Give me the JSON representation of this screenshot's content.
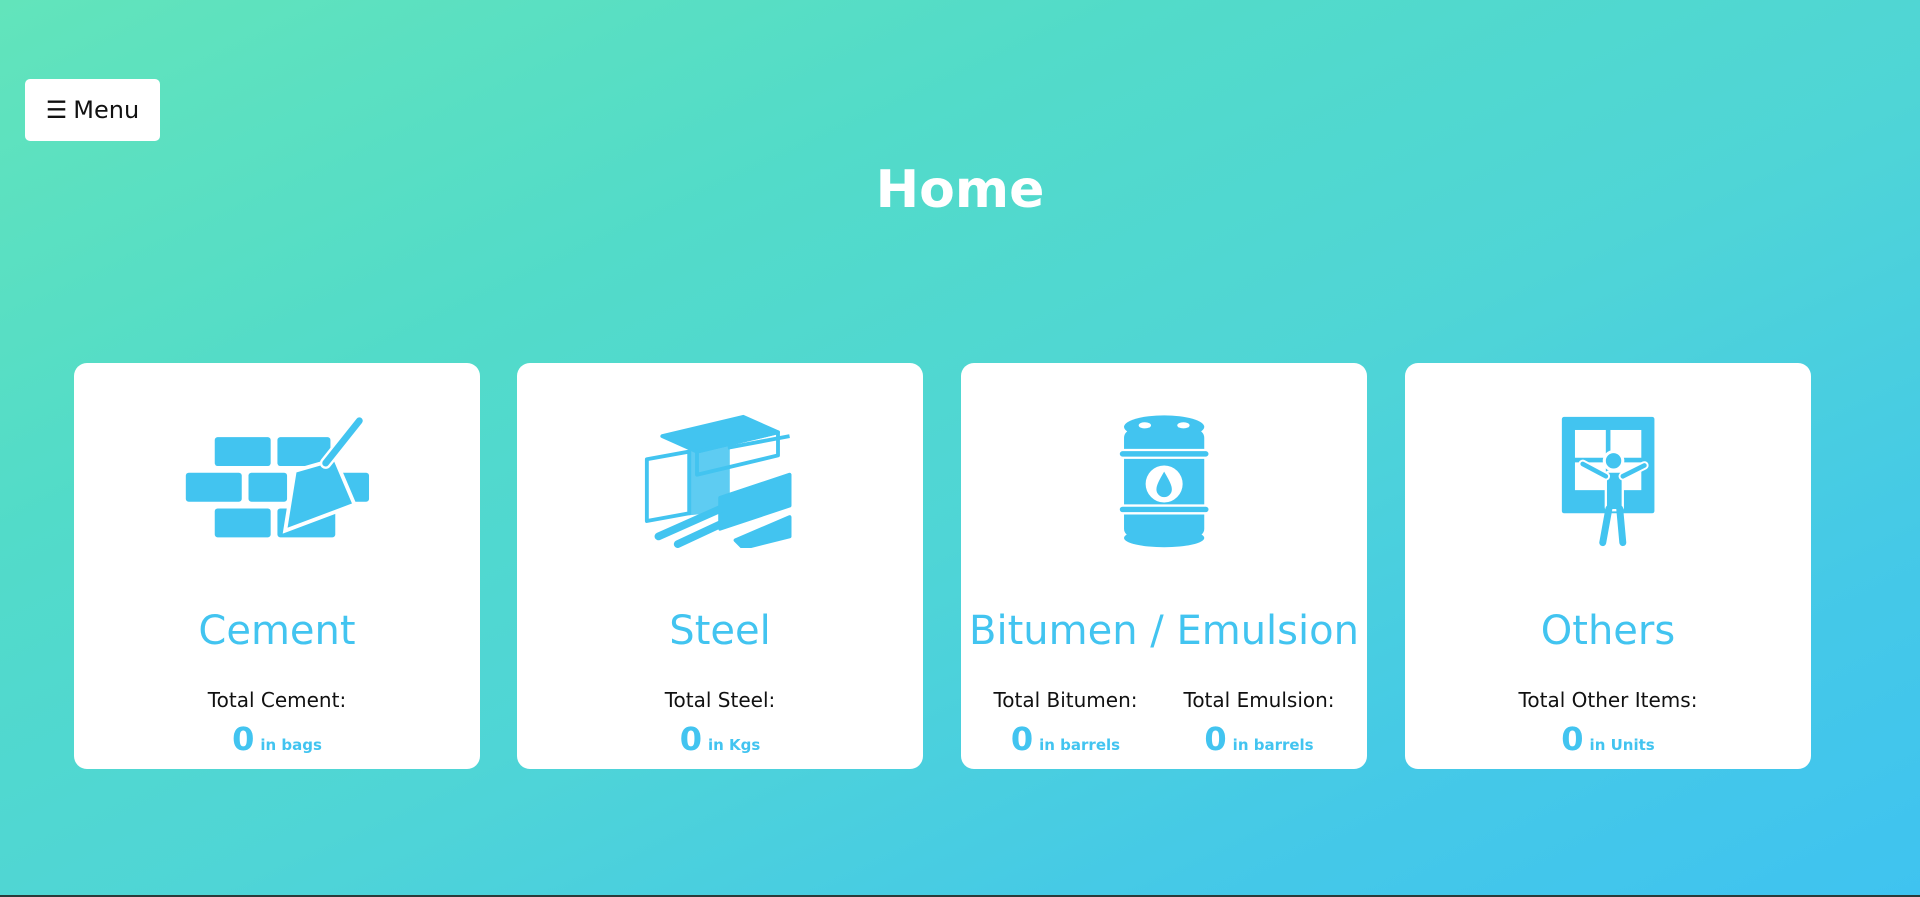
{
  "menu": {
    "glyph": "☰",
    "label": "Menu"
  },
  "page": {
    "title": "Home"
  },
  "colors": {
    "accent": "#42c4f0",
    "card_bg": "#ffffff",
    "title": "#ffffff"
  },
  "cards": [
    {
      "title": "Cement",
      "icon": "brick-trowel-icon",
      "stats": [
        {
          "label": "Total Cement:",
          "value": "0",
          "unit": "in bags"
        }
      ]
    },
    {
      "title": "Steel",
      "icon": "steel-beams-icon",
      "stats": [
        {
          "label": "Total Steel:",
          "value": "0",
          "unit": "in Kgs"
        }
      ]
    },
    {
      "title": "Bitumen / Emulsion",
      "icon": "oil-barrel-icon",
      "stats": [
        {
          "label": "Total Bitumen:",
          "value": "0",
          "unit": "in barrels"
        },
        {
          "label": "Total Emulsion:",
          "value": "0",
          "unit": "in barrels"
        }
      ]
    },
    {
      "title": "Others",
      "icon": "worker-window-icon",
      "stats": [
        {
          "label": "Total Other Items:",
          "value": "0",
          "unit": "in Units"
        }
      ]
    }
  ]
}
